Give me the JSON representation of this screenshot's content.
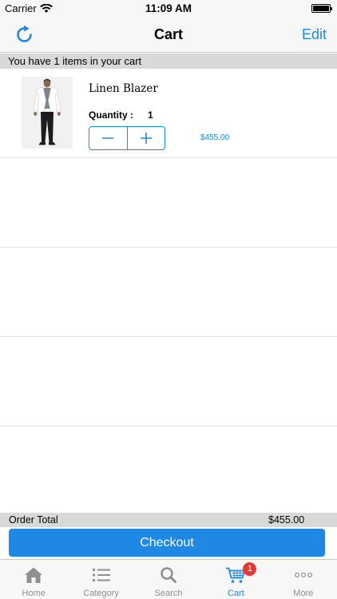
{
  "status_bar": {
    "carrier": "Carrier",
    "time": "11:09 AM"
  },
  "nav": {
    "title": "Cart",
    "edit_label": "Edit",
    "refresh_icon": "refresh-icon"
  },
  "cart": {
    "info_text": "You have 1 items in your cart",
    "items": [
      {
        "name": "Linen Blazer",
        "quantity_label": "Quantity :",
        "quantity": "1",
        "price": "$455.00"
      }
    ]
  },
  "order_total": {
    "label": "Order Total",
    "value": "$455.00"
  },
  "checkout_label": "Checkout",
  "tabs": [
    {
      "label": "Home",
      "icon": "home-icon"
    },
    {
      "label": "Category",
      "icon": "list-icon"
    },
    {
      "label": "Search",
      "icon": "search-icon"
    },
    {
      "label": "Cart",
      "icon": "cart-icon",
      "badge": "1"
    },
    {
      "label": "More",
      "icon": "more-icon"
    }
  ],
  "colors": {
    "accent": "#1f87e4",
    "badge": "#e53935",
    "strip": "#d9d9d9"
  }
}
